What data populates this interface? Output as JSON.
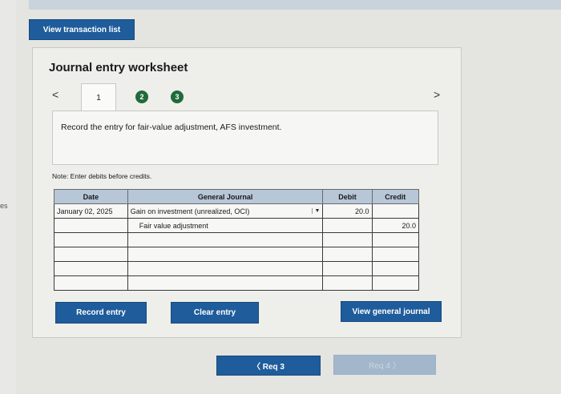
{
  "header": {
    "view_list_label": "View transaction list"
  },
  "edge": {
    "text": "es"
  },
  "worksheet": {
    "title": "Journal entry worksheet",
    "nav": {
      "prev": "<",
      "next": ">"
    },
    "steps": [
      "1",
      "2",
      "3"
    ],
    "instruction": "Record the entry for fair-value adjustment, AFS investment.",
    "note": "Note: Enter debits before credits.",
    "table": {
      "headers": {
        "date": "Date",
        "journal": "General Journal",
        "debit": "Debit",
        "credit": "Credit"
      },
      "rows": [
        {
          "date": "January 02, 2025",
          "account": "Gain on investment (unrealized, OCI)",
          "debit": "20.0",
          "credit": ""
        },
        {
          "date": "",
          "account": "Fair value adjustment",
          "debit": "",
          "credit": "20.0"
        },
        {
          "date": "",
          "account": "",
          "debit": "",
          "credit": ""
        },
        {
          "date": "",
          "account": "",
          "debit": "",
          "credit": ""
        },
        {
          "date": "",
          "account": "",
          "debit": "",
          "credit": ""
        },
        {
          "date": "",
          "account": "",
          "debit": "",
          "credit": ""
        }
      ]
    },
    "buttons": {
      "record": "Record entry",
      "clear": "Clear entry",
      "view_general": "View general journal"
    }
  },
  "pager": {
    "prev_label": "〈  Req 3",
    "next_label": "Req 4  〉"
  },
  "colors": {
    "button_blue": "#1f5c9b",
    "step_green": "#1f6b3a",
    "header_blue": "#b7c7d8"
  }
}
